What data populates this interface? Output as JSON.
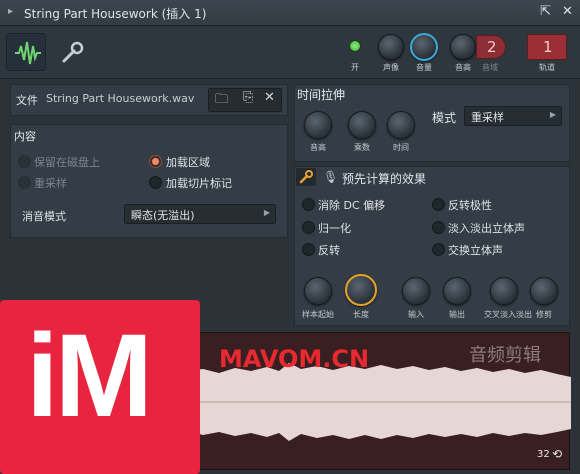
{
  "window": {
    "title": "String Part Housework (插入 1)",
    "arrow_icon": "▸",
    "detach_icon": "⇱",
    "close_icon": "✕"
  },
  "toolbar": {
    "led_label": "开",
    "pan_label": "声像",
    "volume_label": "音量",
    "pitch_label": "音高",
    "range_label": "音域",
    "range_value": "2",
    "track_label": "轨道",
    "track_value": "1"
  },
  "file": {
    "label": "文件",
    "name": "String Part Housework.wav"
  },
  "content": {
    "header": "内容",
    "keep_on_disk": "保留在磁盘上",
    "resample": "重采样",
    "load_regions": "加载区域",
    "load_slice_markers": "加载切片标记",
    "mute_mode_label": "消音模式",
    "mute_mode_value": "瞬态(无溢出)"
  },
  "time_stretch": {
    "header": "时间拉伸",
    "pitch_label": "音高",
    "mul_label": "乘数",
    "time_label": "时间",
    "mode_label": "模式",
    "mode_value": "重采样"
  },
  "precomputed": {
    "header": "预先计算的效果",
    "remove_dc": "消除 DC 偏移",
    "normalize": "归一化",
    "reverse": "反转",
    "reverse_polarity": "反转极性",
    "fade_stereo": "淡入淡出立体声",
    "swap_stereo": "交换立体声",
    "knobs": [
      "样本起始",
      "长度",
      "输入",
      "输出",
      "交叉淡入淡出",
      "修剪"
    ]
  },
  "waveform": {
    "watermark_main": "MAVOM.CN",
    "watermark_sub": "音频剪辑",
    "logo_text": "iM",
    "counter": "32"
  }
}
